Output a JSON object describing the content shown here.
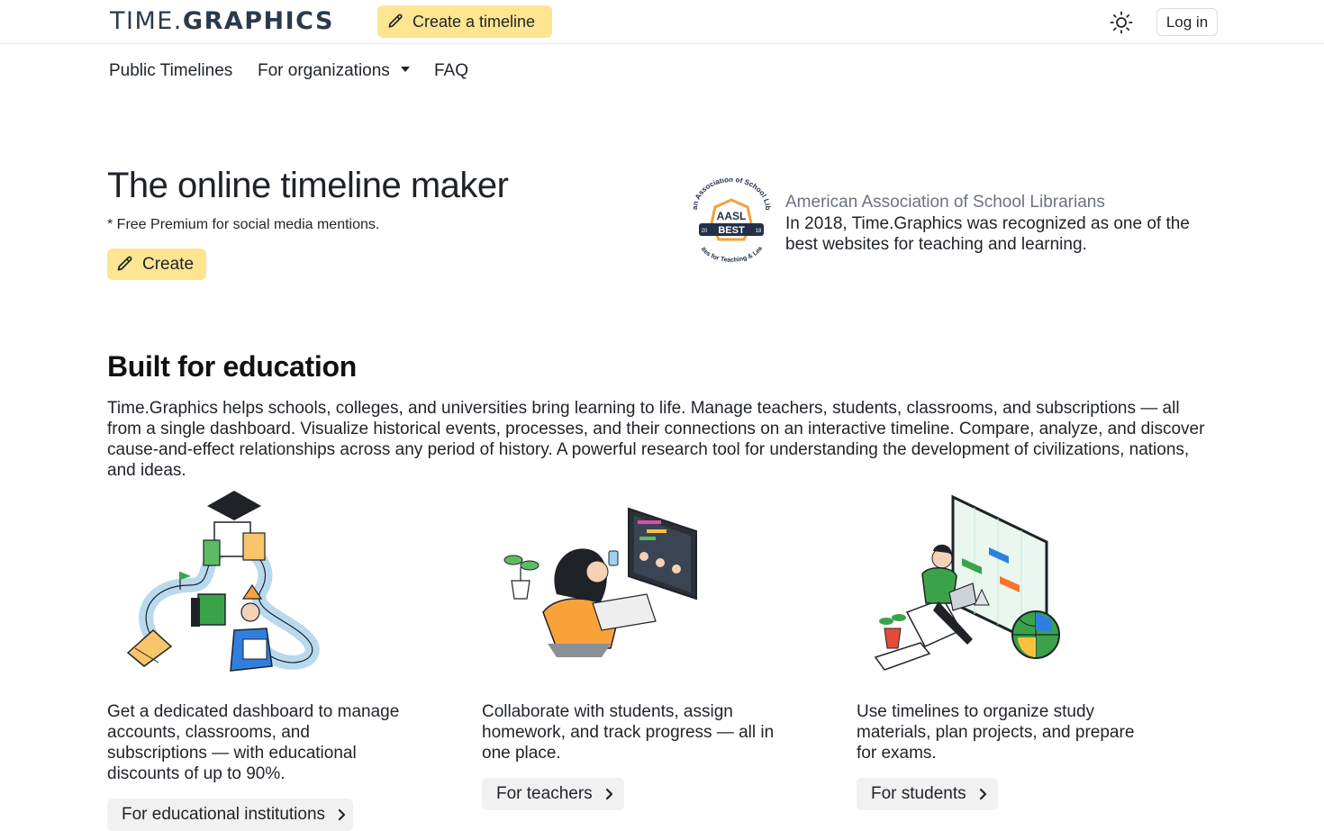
{
  "header": {
    "logo_part1": "TIME.",
    "logo_part2": "GRAPHICS",
    "create_timeline_label": "Create a timeline",
    "login_label": "Log in",
    "theme_icon": "sun-icon"
  },
  "nav": {
    "items": [
      {
        "label": "Public Timelines"
      },
      {
        "label": "For organizations"
      },
      {
        "label": "FAQ"
      }
    ]
  },
  "hero": {
    "title": "The online timeline maker",
    "note": "* Free Premium for social media mentions.",
    "create_label": "Create"
  },
  "award": {
    "badge_arc_top": "American Association of School Librarians",
    "badge_aasl": "AASL",
    "badge_best": "BEST",
    "badge_year_left": "20",
    "badge_year_right": "18",
    "badge_arc_bottom": "Websites for Teaching & Learning",
    "org": "American Association of School Librarians",
    "text": "In 2018, Time.Graphics was recognized as one of the best websites for teaching and learning."
  },
  "education": {
    "title": "Built for education",
    "text": "Time.Graphics helps schools, colleges, and universities bring learning to life. Manage teachers, students, classrooms, and subscriptions — all from a single dashboard. Visualize historical events, processes, and their connections on an interactive timeline. Compare, analyze, and discover cause-and-effect relationships across any period of history. A powerful research tool for understanding the development of civilizations, nations, and ideas.",
    "cards": [
      {
        "text": "Get a dedicated dashboard to manage accounts, classrooms, and subscriptions — with educational discounts of up to 90%.",
        "button": "For educational institutions"
      },
      {
        "text": "Collaborate with students, assign homework, and track progress — all in one place.",
        "button": "For teachers"
      },
      {
        "text": "Use timelines to organize study materials, plan projects, and prepare for exams.",
        "button": "For students"
      }
    ]
  },
  "colors": {
    "accent_yellow": "#fde592",
    "text": "#1f2328",
    "muted": "#6b7280",
    "button_gray": "#f1f1f2",
    "logo": "#2b3a4a"
  }
}
